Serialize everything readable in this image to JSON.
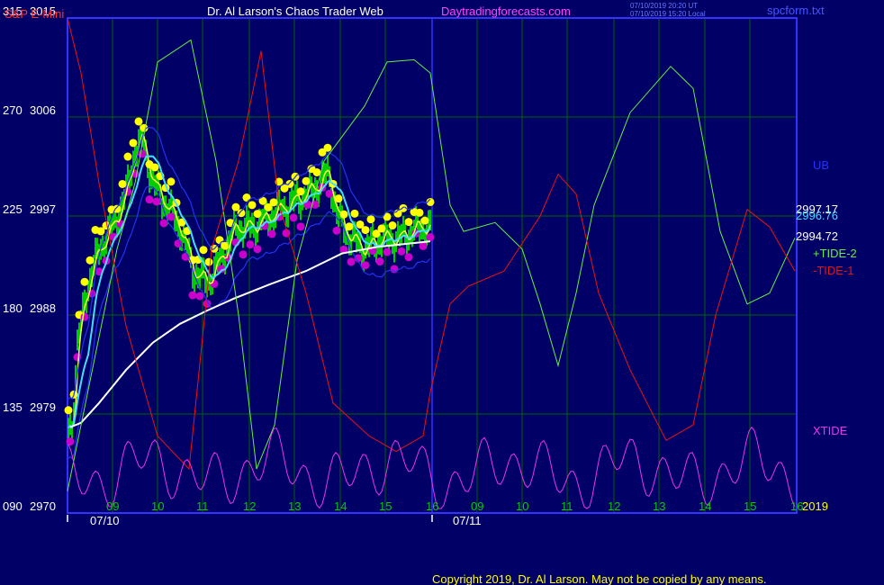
{
  "header": {
    "instrument": "S&P E-Mini",
    "title": "Dr. Al Larson's Chaos Trader Web",
    "site": "Daytradingforecasts.com",
    "stamp1": "07/10/2019 20:20 UT",
    "stamp2": "07/10/2019 15:20 Local",
    "file": "spcform.txt"
  },
  "footer": {
    "copyright": "Copyright 2019, Dr. Al Larson. May not be copied by any means.",
    "year": "2019"
  },
  "colors": {
    "background": "#000066",
    "grid": "#006400",
    "frame": "#3333ff",
    "price_bars": "#00cc00",
    "highs": "#ffff00",
    "lows": "#cc00cc",
    "ma_fast": "#ffff44",
    "ma_mid": "#44ddff",
    "ma_slow": "#ffffff",
    "bands": "#2233ee",
    "tide2": "#66ee44",
    "tide1": "#ee1111",
    "xtide": "#ee33ee"
  },
  "chart_data": {
    "type": "line",
    "y_left_labels": [
      {
        "tide": "315",
        "price": "3015"
      },
      {
        "tide": "270",
        "price": "3006"
      },
      {
        "tide": "225",
        "price": "2997"
      },
      {
        "tide": "180",
        "price": "2988"
      },
      {
        "tide": "135",
        "price": "2979"
      },
      {
        "tide": "090",
        "price": "2970"
      }
    ],
    "price_range": [
      2970,
      3015
    ],
    "tide_range": [
      90,
      315
    ],
    "x_hours": [
      "09",
      "10",
      "11",
      "12",
      "13",
      "14",
      "15",
      "16",
      "09",
      "10",
      "11",
      "12",
      "13",
      "14",
      "15",
      "16"
    ],
    "x_dates": [
      "07/10",
      "07/11"
    ],
    "right_labels": {
      "ub": "UB",
      "v1": "2997.17",
      "v2": "2996.76",
      "v3": "2994.72",
      "tide2": "+TIDE-2",
      "tide1": "-TIDE-1",
      "xtide": "XTIDE"
    },
    "series": [
      {
        "name": "+TIDE-2"
      },
      {
        "name": "-TIDE-1"
      },
      {
        "name": "XTIDE"
      }
    ],
    "grid": true
  }
}
